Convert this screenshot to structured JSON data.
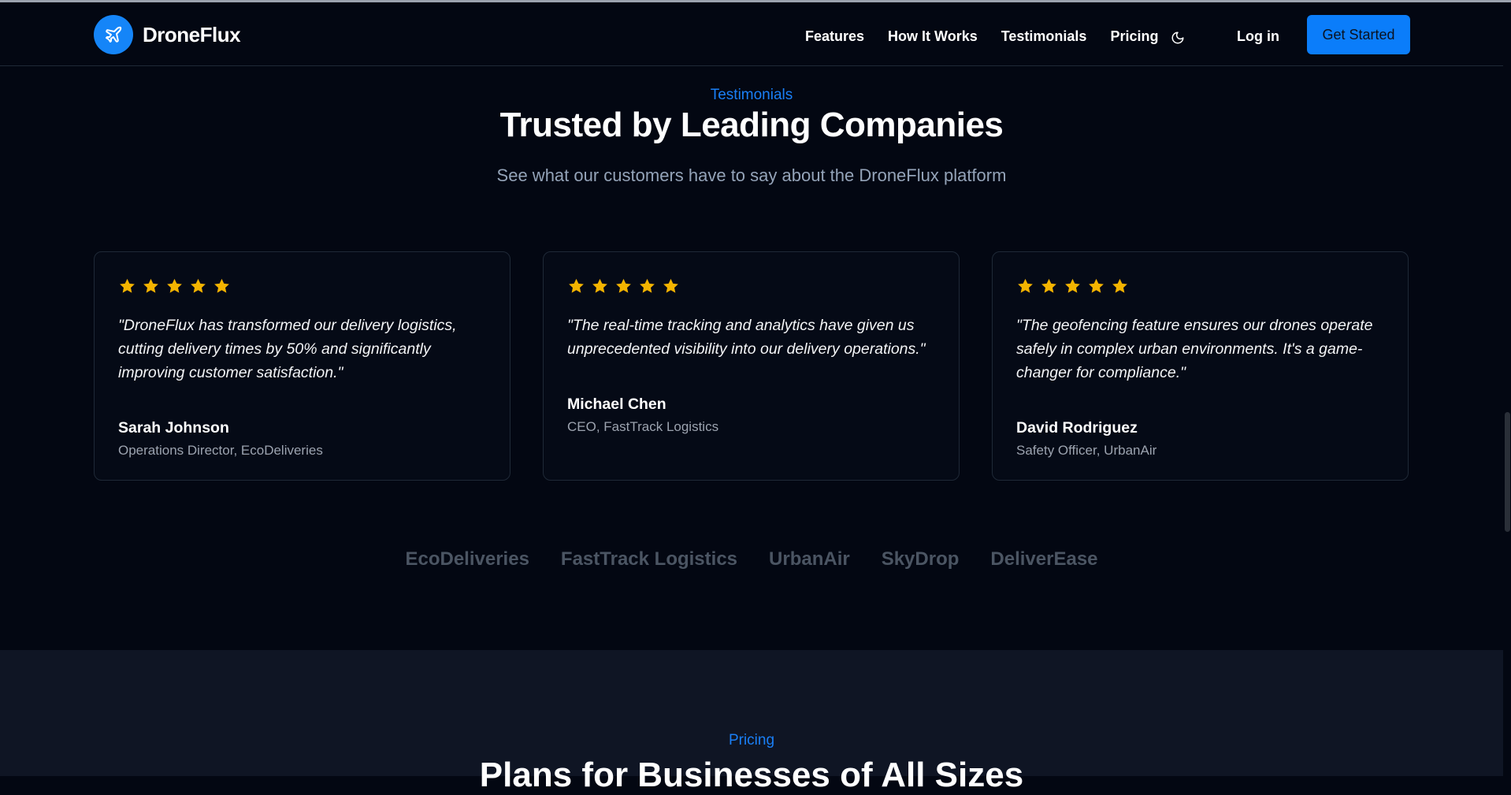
{
  "header": {
    "brand": "DroneFlux",
    "nav": [
      "Features",
      "How It Works",
      "Testimonials",
      "Pricing"
    ],
    "theme_icon": "moon-icon",
    "login": "Log in",
    "cta": "Get Started"
  },
  "testimonials": {
    "eyebrow": "Testimonials",
    "title": "Trusted by Leading Companies",
    "subtitle": "See what our customers have to say about the DroneFlux platform",
    "items": [
      {
        "rating": 5,
        "quote": "\"DroneFlux has transformed our delivery logistics, cutting delivery times by 50% and significantly improving customer satisfaction.\"",
        "name": "Sarah Johnson",
        "role": "Operations Director, EcoDeliveries"
      },
      {
        "rating": 5,
        "quote": "\"The real-time tracking and analytics have given us unprecedented visibility into our delivery operations.\"",
        "name": "Michael Chen",
        "role": "CEO, FastTrack Logistics"
      },
      {
        "rating": 5,
        "quote": "\"The geofencing feature ensures our drones operate safely in complex urban environments. It's a game-changer for compliance.\"",
        "name": "David Rodriguez",
        "role": "Safety Officer, UrbanAir"
      }
    ],
    "brands": [
      "EcoDeliveries",
      "FastTrack Logistics",
      "UrbanAir",
      "SkyDrop",
      "DeliverEase"
    ]
  },
  "pricing": {
    "eyebrow": "Pricing",
    "title": "Plans for Businesses of All Sizes"
  },
  "colors": {
    "accent": "#0b7dfa",
    "star": "#f4b400",
    "background": "#030712"
  }
}
